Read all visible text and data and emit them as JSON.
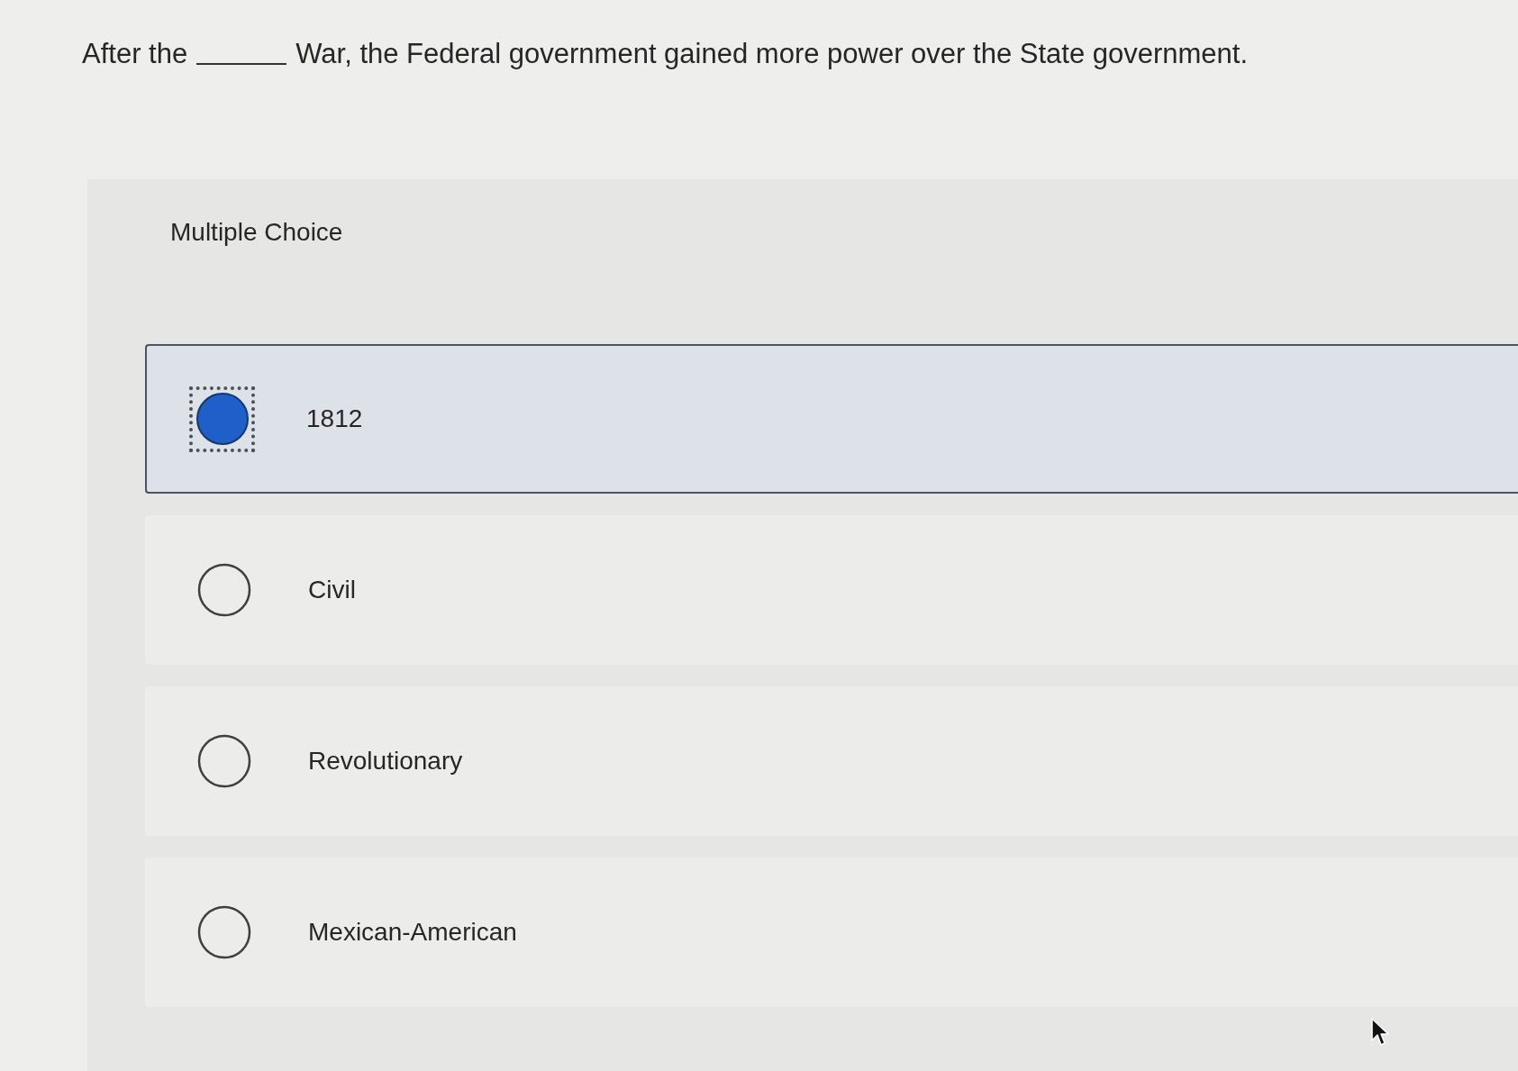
{
  "question": {
    "text_before": "After the",
    "text_after": "War, the Federal government gained more power over the State government."
  },
  "question_type": "Multiple Choice",
  "options": [
    {
      "label": "1812",
      "selected": true
    },
    {
      "label": "Civil",
      "selected": false
    },
    {
      "label": "Revolutionary",
      "selected": false
    },
    {
      "label": "Mexican-American",
      "selected": false
    }
  ]
}
